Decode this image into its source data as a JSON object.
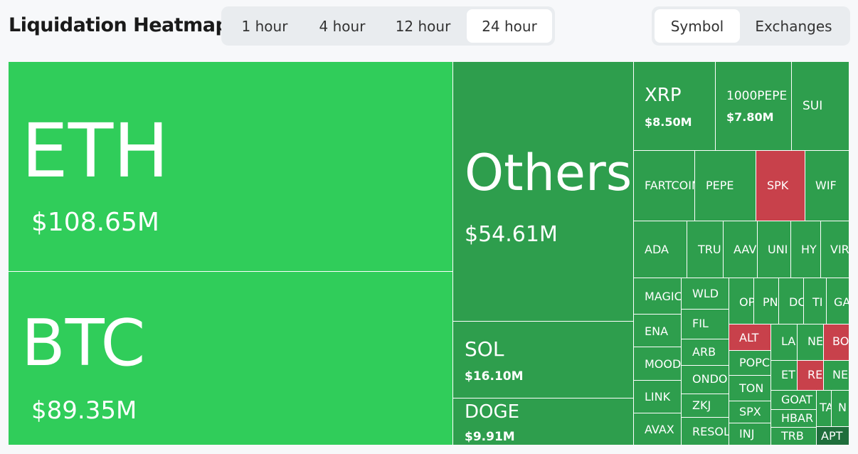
{
  "header": {
    "title": "Liquidation Heatmap",
    "time_options": [
      "1 hour",
      "4 hour",
      "12 hour",
      "24 hour"
    ],
    "time_selected": "24 hour",
    "view_options": [
      "Symbol",
      "Exchanges"
    ],
    "view_selected": "Symbol"
  },
  "heatmap": {
    "cells": [
      {
        "symbol": "ETH",
        "value": "$108.65M",
        "color": "#30cd5a"
      },
      {
        "symbol": "BTC",
        "value": "$89.35M",
        "color": "#30cd5a"
      },
      {
        "symbol": "Others",
        "value": "$54.61M",
        "color": "#2e9e4d"
      },
      {
        "symbol": "SOL",
        "value": "$16.10M",
        "color": "#2e9e4d"
      },
      {
        "symbol": "DOGE",
        "value": "$9.91M",
        "color": "#2e9e4d"
      },
      {
        "symbol": "XRP",
        "value": "$8.50M",
        "color": "#2e9e4d"
      },
      {
        "symbol": "1000PEPE",
        "value": "$7.80M",
        "color": "#2e9e4d"
      },
      {
        "symbol": "SUI",
        "value": "",
        "color": "#2e9e4d"
      },
      {
        "symbol": "FARTCOIN",
        "value": "",
        "color": "#2e9e4d"
      },
      {
        "symbol": "PEPE",
        "value": "",
        "color": "#2e9e4d"
      },
      {
        "symbol": "SPK",
        "value": "",
        "color": "#c8414b"
      },
      {
        "symbol": "WIF",
        "value": "",
        "color": "#2e9e4d"
      },
      {
        "symbol": "ADA",
        "value": "",
        "color": "#2e9e4d"
      },
      {
        "symbol": "TRU",
        "value": "",
        "color": "#2e9e4d"
      },
      {
        "symbol": "AAV",
        "value": "",
        "color": "#2e9e4d"
      },
      {
        "symbol": "UNI",
        "value": "",
        "color": "#2e9e4d"
      },
      {
        "symbol": "HY",
        "value": "",
        "color": "#2e9e4d"
      },
      {
        "symbol": "VIR",
        "value": "",
        "color": "#2e9e4d"
      },
      {
        "symbol": "MAGIC",
        "value": "",
        "color": "#2e9e4d"
      },
      {
        "symbol": "WLD",
        "value": "",
        "color": "#2e9e4d"
      },
      {
        "symbol": "OP",
        "value": "",
        "color": "#2e9e4d"
      },
      {
        "symbol": "PN",
        "value": "",
        "color": "#2e9e4d"
      },
      {
        "symbol": "DC",
        "value": "",
        "color": "#2e9e4d"
      },
      {
        "symbol": "TI",
        "value": "",
        "color": "#2e9e4d"
      },
      {
        "symbol": "GA",
        "value": "",
        "color": "#2e9e4d"
      },
      {
        "symbol": "FIL",
        "value": "",
        "color": "#2e9e4d"
      },
      {
        "symbol": "ENA",
        "value": "",
        "color": "#2e9e4d"
      },
      {
        "symbol": "ALT",
        "value": "",
        "color": "#c8414b"
      },
      {
        "symbol": "LA",
        "value": "",
        "color": "#2e9e4d"
      },
      {
        "symbol": "NE",
        "value": "",
        "color": "#2e9e4d"
      },
      {
        "symbol": "BO",
        "value": "",
        "color": "#c8414b"
      },
      {
        "symbol": "ARB",
        "value": "",
        "color": "#2e9e4d"
      },
      {
        "symbol": "MOOD",
        "value": "",
        "color": "#2e9e4d"
      },
      {
        "symbol": "POPC",
        "value": "",
        "color": "#2e9e4d"
      },
      {
        "symbol": "ET",
        "value": "",
        "color": "#2e9e4d"
      },
      {
        "symbol": "RE",
        "value": "",
        "color": "#c8414b"
      },
      {
        "symbol": "NE",
        "value": "",
        "color": "#2e9e4d"
      },
      {
        "symbol": "ONDO",
        "value": "",
        "color": "#2e9e4d"
      },
      {
        "symbol": "TON",
        "value": "",
        "color": "#2e9e4d"
      },
      {
        "symbol": "LINK",
        "value": "",
        "color": "#2e9e4d"
      },
      {
        "symbol": "GOAT",
        "value": "",
        "color": "#2e9e4d"
      },
      {
        "symbol": "TA",
        "value": "",
        "color": "#2e9e4d"
      },
      {
        "symbol": "N",
        "value": "",
        "color": "#2e9e4d"
      },
      {
        "symbol": "ZKJ",
        "value": "",
        "color": "#2e9e4d"
      },
      {
        "symbol": "SPX",
        "value": "",
        "color": "#2e9e4d"
      },
      {
        "symbol": "HBAR",
        "value": "",
        "color": "#2e9e4d"
      },
      {
        "symbol": "AVAX",
        "value": "",
        "color": "#2e9e4d"
      },
      {
        "symbol": "RESOLV",
        "value": "",
        "color": "#2e9e4d"
      },
      {
        "symbol": "INJ",
        "value": "",
        "color": "#2e9e4d"
      },
      {
        "symbol": "TRB",
        "value": "",
        "color": "#2e9e4d"
      },
      {
        "symbol": "APT",
        "value": "",
        "color": "#1f6e3c"
      }
    ]
  }
}
